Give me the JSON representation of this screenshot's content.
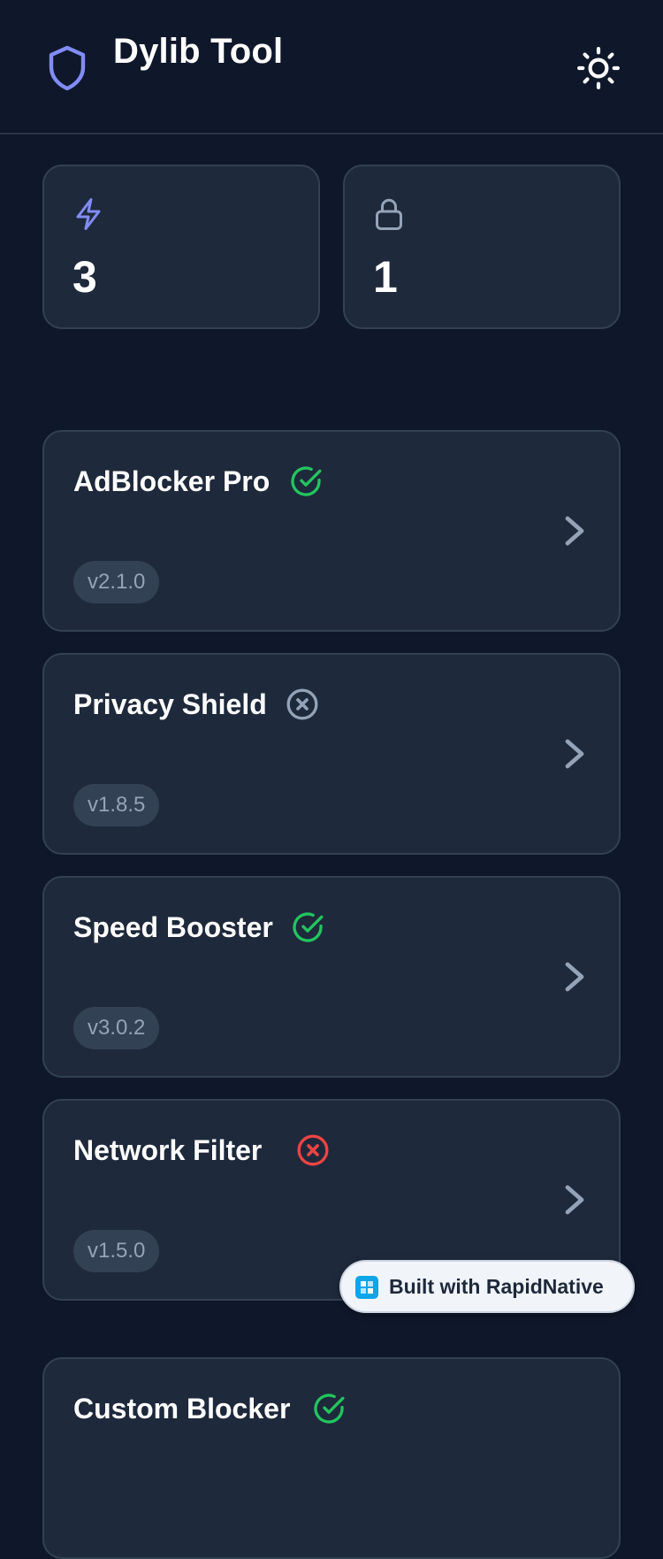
{
  "header": {
    "title": "Dylib Tool",
    "logo_icon": "shield-icon",
    "theme_icon": "sun-icon"
  },
  "stats": [
    {
      "icon": "lightning-icon",
      "value": "3"
    },
    {
      "icon": "lock-icon",
      "value": "1"
    }
  ],
  "plugins": [
    {
      "name": "AdBlocker Pro",
      "status": "enabled",
      "version": "v2.1.0"
    },
    {
      "name": "Privacy Shield",
      "status": "disabled",
      "version": "v1.8.5"
    },
    {
      "name": "Speed Booster",
      "status": "enabled",
      "version": "v3.0.2"
    },
    {
      "name": "Network Filter",
      "status": "error",
      "version": "v1.5.0"
    },
    {
      "name": "Custom Blocker",
      "status": "enabled",
      "version": ""
    }
  ],
  "badge": {
    "label": "Built with RapidNative"
  },
  "colors": {
    "background": "#0f172a",
    "card": "#1e293b",
    "accent": "#818cf8",
    "enabled": "#22c55e",
    "disabled": "#94a3b8",
    "error": "#ef4444"
  }
}
